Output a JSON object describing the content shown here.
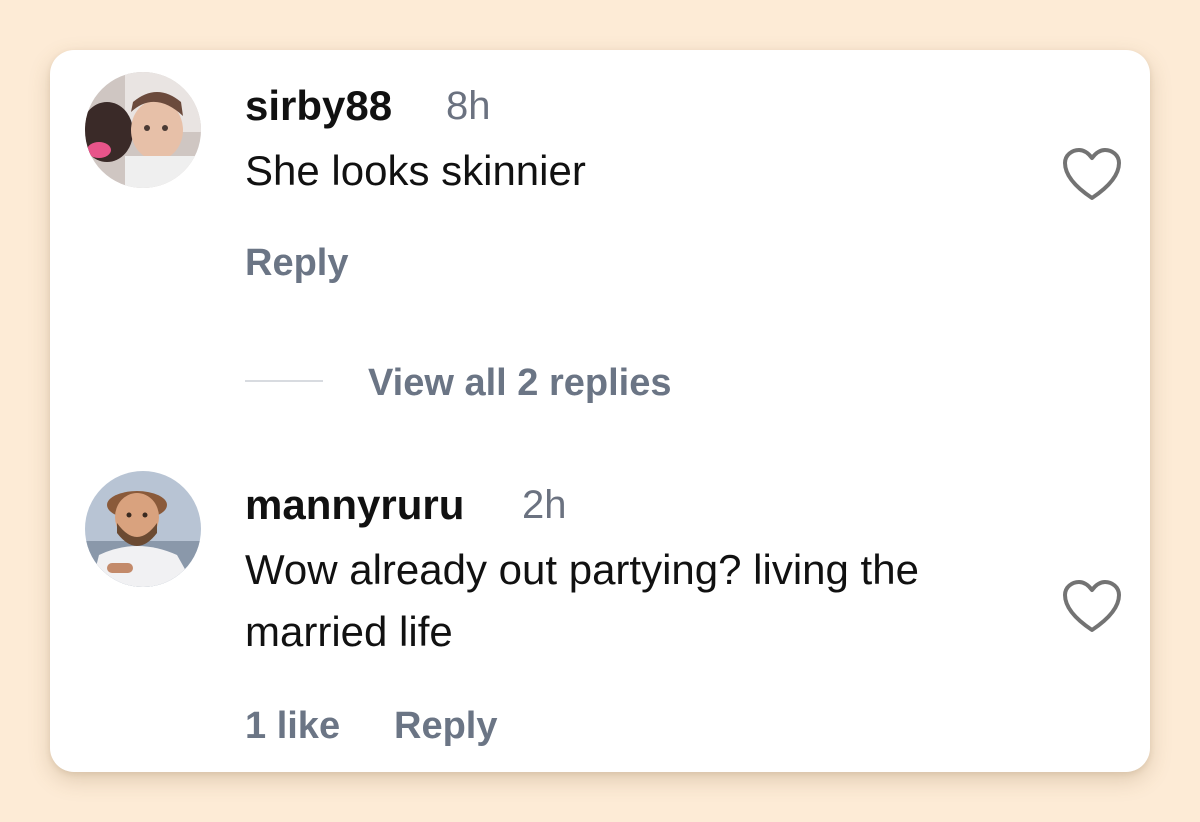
{
  "comments": [
    {
      "username": "sirby88",
      "time": "8h",
      "text": "She looks skinnier",
      "reply_label": "Reply",
      "view_replies_label": "View all 2 replies"
    },
    {
      "username": "mannyruru",
      "time": "2h",
      "text": "Wow already out partying? living the married life",
      "likes_label": "1 like",
      "reply_label": "Reply"
    }
  ],
  "icons": {
    "like": "heart-outline-icon"
  },
  "colors": {
    "background": "#fdebd6",
    "card": "#ffffff",
    "text_primary": "#111111",
    "text_secondary": "#6b7585"
  }
}
